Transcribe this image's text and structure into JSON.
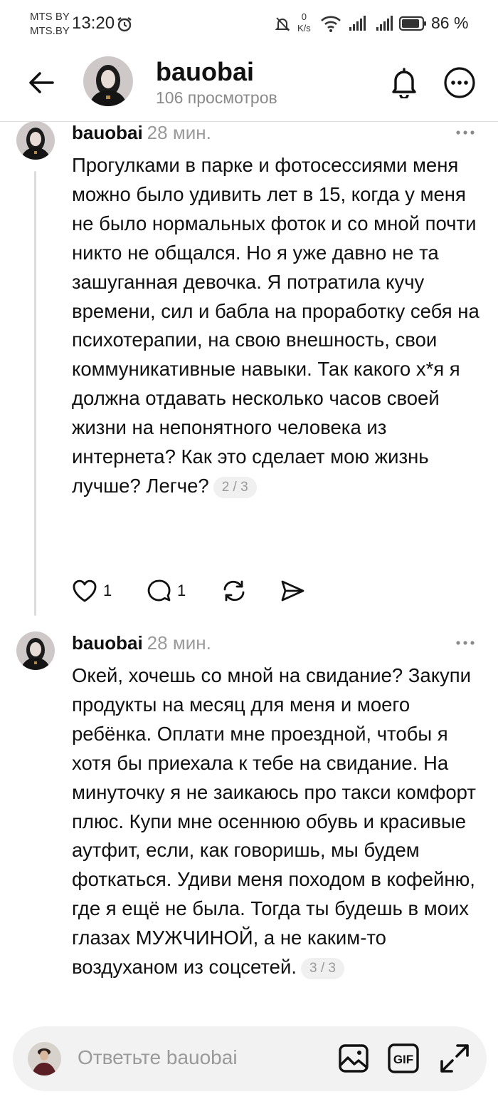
{
  "status_bar": {
    "carrier_line1": "MTS BY",
    "carrier_line2": "MTS.BY",
    "time": "13:20",
    "net_speed_value": "0",
    "net_speed_unit": "K/s",
    "battery": "86 %"
  },
  "header": {
    "username": "bauobai",
    "views": "106 просмотров"
  },
  "posts": [
    {
      "author": "bauobai",
      "time": "28 мин.",
      "text": "Прогулками в парке и фотосессиями меня можно было удивить лет в 15, когда у меня не было нормальных фоток и со мной почти никто не общался. Но я уже давно не та зашуганная девочка. Я потратила кучу времени, сил и бабла на проработку себя на психотерапии, на свою внешность, свои коммуникативные навыки. Так какого х*я я должна отдавать несколько часов своей жизни на непонятного человека из интернета? Как это сделает мою жизнь лучше? Легче?",
      "pager": "2 / 3",
      "likes": "1",
      "comments": "1"
    },
    {
      "author": "bauobai",
      "time": "28 мин.",
      "text": "Окей, хочешь со мной на свидание? Закупи продукты на месяц для меня и моего ребёнка. Оплати мне проездной, чтобы я хотя бы приехала к тебе на свидание. На минуточку я не заикаюсь про такси комфорт плюс. Купи мне осеннюю обувь и красивые аутфит, если, как говоришь, мы будем фоткаться. Удиви меня походом в кофейню, где я ещё не была. Тогда ты будешь в моих глазах МУЖЧИНОЙ, а не каким-то воздуханом из соцсетей.",
      "pager": "3 / 3"
    }
  ],
  "reply": {
    "placeholder": "Ответьте bauobai",
    "gif_label": "GIF"
  },
  "colors": {
    "text": "#111111",
    "muted": "#9a9a9a",
    "reply_bg": "#f2f2f2",
    "thread_line": "#dcdcdc"
  }
}
